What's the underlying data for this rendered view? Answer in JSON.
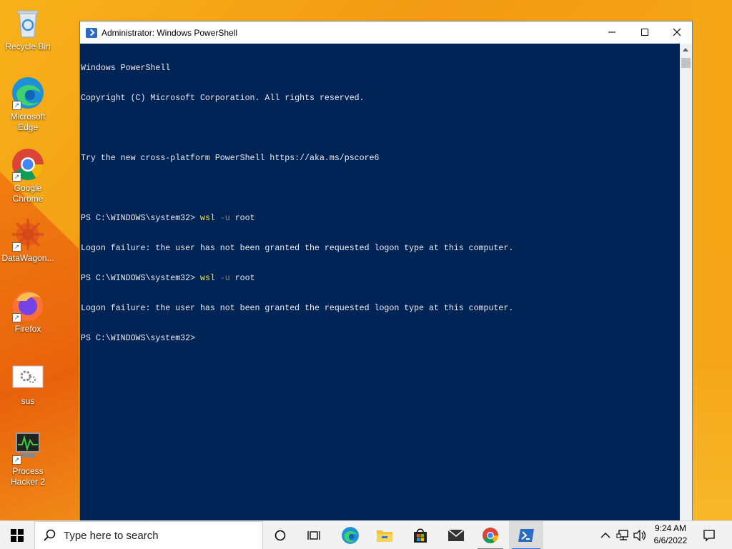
{
  "desktop": {
    "icons": [
      {
        "label": "Recycle Bin"
      },
      {
        "label": "Microsoft Edge"
      },
      {
        "label": "Google Chrome"
      },
      {
        "label": "DataWagon..."
      },
      {
        "label": "Firefox"
      },
      {
        "label": "sus"
      },
      {
        "label": "Process Hacker 2"
      }
    ]
  },
  "window": {
    "title": "Administrator: Windows PowerShell",
    "terminal_lines": [
      "Windows PowerShell",
      "Copyright (C) Microsoft Corporation. All rights reserved.",
      "",
      "Try the new cross-platform PowerShell https://aka.ms/pscore6",
      "",
      "PS C:\\WINDOWS\\system32> ",
      "Logon failure: the user has not been granted the requested logon type at this computer.",
      "PS C:\\WINDOWS\\system32> ",
      "Logon failure: the user has not been granted the requested logon type at this computer.",
      "PS C:\\WINDOWS\\system32>"
    ],
    "command": {
      "exe": "wsl",
      "flag": "-u",
      "arg": "root"
    }
  },
  "taskbar": {
    "search_placeholder": "Type here to search",
    "apps": [
      "task-view",
      "widgets",
      "edge",
      "file-explorer",
      "microsoft-store",
      "mail",
      "chrome",
      "powershell"
    ],
    "clock": {
      "time": "9:24 AM",
      "date": "6/6/2022"
    }
  },
  "colors": {
    "terminal_bg": "#012456",
    "terminal_fg": "#eeedf0",
    "command_keyword": "#f0e54a",
    "command_flag": "#8a8a8a"
  }
}
